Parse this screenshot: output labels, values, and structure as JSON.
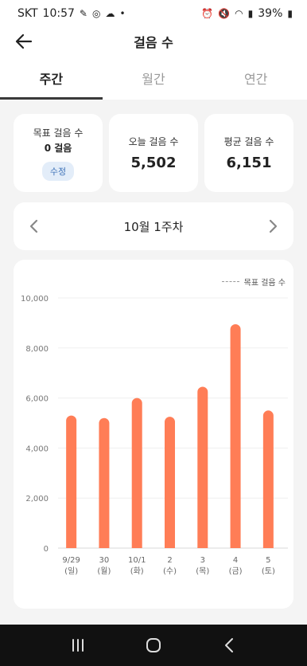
{
  "status_bar": {
    "carrier": "SKT",
    "time": "10:57",
    "battery": "39%"
  },
  "header": {
    "title": "걸음 수"
  },
  "tabs": [
    {
      "label": "주간",
      "active": true
    },
    {
      "label": "월간",
      "active": false
    },
    {
      "label": "연간",
      "active": false
    }
  ],
  "stats": {
    "goal": {
      "label": "목표 걸음 수",
      "value": "0 걸음",
      "edit_label": "수정"
    },
    "today": {
      "label": "오늘 걸음 수",
      "value": "5,502"
    },
    "average": {
      "label": "평균 걸음 수",
      "value": "6,151"
    }
  },
  "week_nav": {
    "label": "10월 1주차"
  },
  "legend": {
    "goal_line": "목표 걸음 수"
  },
  "colors": {
    "bar": "#ff7d56",
    "accent_button_bg": "#e3edf9",
    "accent_button_text": "#3f73b8"
  },
  "chart_data": {
    "type": "bar",
    "categories": [
      "9/29\n(일)",
      "30\n(월)",
      "10/1\n(화)",
      "2\n(수)",
      "3\n(목)",
      "4\n(금)",
      "5\n(토)"
    ],
    "category_lines": [
      [
        "9/29",
        "(일)"
      ],
      [
        "30",
        "(월)"
      ],
      [
        "10/1",
        "(화)"
      ],
      [
        "2",
        "(수)"
      ],
      [
        "3",
        "(목)"
      ],
      [
        "4",
        "(금)"
      ],
      [
        "5",
        "(토)"
      ]
    ],
    "values": [
      5300,
      5200,
      6000,
      5250,
      6450,
      8950,
      5500
    ],
    "ylim": [
      0,
      10000
    ],
    "y_ticks": [
      0,
      2000,
      4000,
      6000,
      8000,
      10000
    ],
    "y_tick_labels": [
      "0",
      "2,000",
      "4,000",
      "6,000",
      "8,000",
      "10,000"
    ],
    "grid": true,
    "legend_position": "top-right"
  }
}
